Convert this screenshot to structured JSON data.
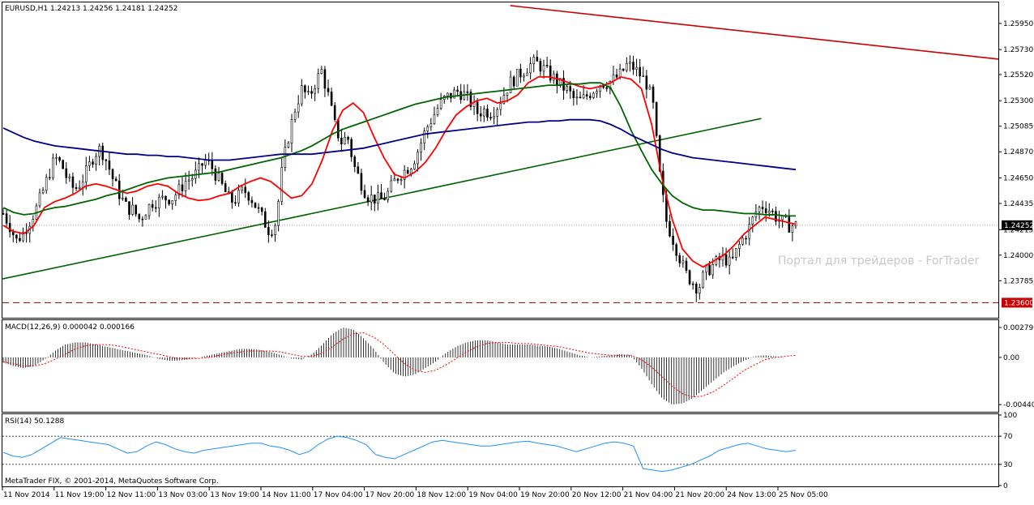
{
  "chart_data": {
    "type": "candlestick",
    "symbol_header": "EURUSD,H1  1.24213 1.24256 1.24181 1.24252",
    "watermark": "Портал для трейдеров - ForTrader",
    "copyright": "MetaTrader FIX, © 2001-2014, MetaQuotes Software Corp.",
    "current_price_label": "1.24252",
    "support_label": "1.23600",
    "price_ylim": [
      1.2348,
      1.2612
    ],
    "price_ticks": [
      "1.25950",
      "1.25730",
      "1.25520",
      "1.25300",
      "1.25085",
      "1.24870",
      "1.24650",
      "1.24435",
      "1.24215",
      "1.24000",
      "1.23785"
    ],
    "x_tick_labels": [
      "11 Nov 2014",
      "11 Nov 19:00",
      "12 Nov 11:00",
      "13 Nov 03:00",
      "13 Nov 19:00",
      "14 Nov 11:00",
      "17 Nov 04:00",
      "17 Nov 20:00",
      "18 Nov 12:00",
      "19 Nov 04:00",
      "19 Nov 20:00",
      "20 Nov 12:00",
      "21 Nov 04:00",
      "21 Nov 20:00",
      "24 Nov 13:00",
      "25 Nov 05:00"
    ],
    "close_series": [
      1.2435,
      1.2425,
      1.2412,
      1.2418,
      1.2428,
      1.2438,
      1.2452,
      1.2468,
      1.2482,
      1.2476,
      1.2462,
      1.2455,
      1.2462,
      1.2472,
      1.2485,
      1.249,
      1.2478,
      1.2462,
      1.245,
      1.244,
      1.2438,
      1.243,
      1.2438,
      1.2445,
      1.2446,
      1.2448,
      1.2448,
      1.2454,
      1.2462,
      1.2465,
      1.247,
      1.248,
      1.2475,
      1.2465,
      1.2455,
      1.2445,
      1.2448,
      1.2455,
      1.245,
      1.244,
      1.243,
      1.242,
      1.2428,
      1.2475,
      1.2502,
      1.2525,
      1.254,
      1.2532,
      1.2545,
      1.2555,
      1.2535,
      1.251,
      1.2495,
      1.25,
      1.2475,
      1.2462,
      1.245,
      1.2448,
      1.2446,
      1.245,
      1.246,
      1.2468,
      1.2472,
      1.2478,
      1.249,
      1.2505,
      1.2515,
      1.2525,
      1.2532,
      1.2535,
      1.2538,
      1.2535,
      1.2528,
      1.252,
      1.2522,
      1.252,
      1.2525,
      1.2535,
      1.2545,
      1.255,
      1.2555,
      1.256,
      1.2562,
      1.2558,
      1.2552,
      1.2548,
      1.2542,
      1.2538,
      1.253,
      1.253,
      1.2535,
      1.254,
      1.2545,
      1.2545,
      1.2548,
      1.2552,
      1.256,
      1.2558,
      1.2552,
      1.2545,
      1.2528,
      1.247,
      1.243,
      1.2415,
      1.24,
      1.2385,
      1.2378,
      1.2372,
      1.2385,
      1.239,
      1.2395,
      1.2398,
      1.2392,
      1.2405,
      1.2415,
      1.2425,
      1.2438,
      1.2442,
      1.2438,
      1.2432,
      1.2428,
      1.2425,
      1.2425
    ],
    "moving_averages": [
      {
        "color": "#ff0000",
        "values": [
          1.2425,
          1.242,
          1.2418,
          1.2425,
          1.244,
          1.2445,
          1.2448,
          1.2452,
          1.2458,
          1.246,
          1.2458,
          1.2455,
          1.2452,
          1.2454,
          1.2458,
          1.246,
          1.2458,
          1.2452,
          1.2448,
          1.2446,
          1.2447,
          1.245,
          1.2452,
          1.2458,
          1.2462,
          1.2465,
          1.2462,
          1.2455,
          1.2448,
          1.245,
          1.246,
          1.248,
          1.2505,
          1.2522,
          1.2528,
          1.252,
          1.25,
          1.2482,
          1.2468,
          1.2465,
          1.247,
          1.2478,
          1.249,
          1.2505,
          1.2518,
          1.2525,
          1.253,
          1.2532,
          1.2528,
          1.253,
          1.2535,
          1.2545,
          1.255,
          1.255,
          1.2548,
          1.2545,
          1.2542,
          1.254,
          1.2542,
          1.2545,
          1.255,
          1.2548,
          1.254,
          1.251,
          1.2465,
          1.243,
          1.2405,
          1.2395,
          1.239,
          1.2395,
          1.24,
          1.2408,
          1.2418,
          1.2425,
          1.2432,
          1.243,
          1.2428,
          1.2426
        ]
      },
      {
        "color": "#006400",
        "values": [
          1.244,
          1.2436,
          1.2434,
          1.2435,
          1.2438,
          1.244,
          1.2441,
          1.2443,
          1.2445,
          1.2447,
          1.245,
          1.2452,
          1.2455,
          1.2458,
          1.2461,
          1.2463,
          1.2465,
          1.2466,
          1.2467,
          1.2468,
          1.2469,
          1.247,
          1.2472,
          1.2474,
          1.2476,
          1.2478,
          1.248,
          1.2482,
          1.2485,
          1.2488,
          1.2492,
          1.2497,
          1.2502,
          1.2506,
          1.2509,
          1.2512,
          1.2515,
          1.2518,
          1.2521,
          1.2524,
          1.2527,
          1.2529,
          1.2531,
          1.2533,
          1.2534,
          1.2535,
          1.2536,
          1.2537,
          1.2538,
          1.2539,
          1.254,
          1.2541,
          1.2542,
          1.2543,
          1.2543,
          1.2544,
          1.2544,
          1.2545,
          1.2545,
          1.2541,
          1.2525,
          1.2505,
          1.2488,
          1.2472,
          1.246,
          1.245,
          1.2444,
          1.244,
          1.2438,
          1.2438,
          1.2437,
          1.2436,
          1.2435,
          1.2435,
          1.2434,
          1.2434,
          1.2433,
          1.2433
        ]
      },
      {
        "color": "#00008b",
        "values": [
          1.2507,
          1.2503,
          1.2499,
          1.2496,
          1.2494,
          1.2492,
          1.2491,
          1.249,
          1.2489,
          1.2488,
          1.2487,
          1.2486,
          1.2485,
          1.2485,
          1.2484,
          1.2484,
          1.2483,
          1.2483,
          1.2482,
          1.2481,
          1.248,
          1.248,
          1.248,
          1.2481,
          1.2482,
          1.2483,
          1.2484,
          1.2485,
          1.2485,
          1.2485,
          1.2485,
          1.2486,
          1.2487,
          1.2488,
          1.2489,
          1.249,
          1.2492,
          1.2494,
          1.2496,
          1.2498,
          1.25,
          1.2502,
          1.2503,
          1.2504,
          1.2505,
          1.2506,
          1.2507,
          1.2508,
          1.2509,
          1.251,
          1.2511,
          1.2512,
          1.2512,
          1.2513,
          1.2513,
          1.2514,
          1.2514,
          1.2514,
          1.2513,
          1.251,
          1.2506,
          1.2501,
          1.2497,
          1.2493,
          1.2489,
          1.2486,
          1.2484,
          1.2482,
          1.2481,
          1.248,
          1.2479,
          1.2478,
          1.2477,
          1.2476,
          1.2475,
          1.2474,
          1.2473,
          1.2472
        ]
      }
    ],
    "trendlines": [
      {
        "color": "#006400",
        "from": [
          0,
          1.238
        ],
        "to": [
          0.762,
          1.2515
        ]
      },
      {
        "color": "#cc0000",
        "from": [
          0.51,
          1.261
        ],
        "to": [
          1.0,
          1.2565
        ]
      }
    ],
    "support_level": 1.236,
    "macd": {
      "header": "MACD(12,26,9) 0.000042 0.000166",
      "ylim": [
        -0.005,
        0.0034
      ],
      "ticks": [
        "0.002796",
        "0.00",
        "-0.004407"
      ],
      "histogram": [
        -0.0005,
        -0.0008,
        -0.001,
        -0.0008,
        -0.0002,
        0.0006,
        0.0012,
        0.0014,
        0.0014,
        0.0012,
        0.001,
        0.0008,
        0.0006,
        0.0004,
        0.0002,
        -0.0001,
        -0.0003,
        -0.0003,
        -0.0002,
        0.0,
        0.0002,
        0.0004,
        0.0006,
        0.0008,
        0.0008,
        0.0007,
        0.0005,
        0.0002,
        -0.0001,
        -0.0002,
        0.0003,
        0.0012,
        0.0022,
        0.0028,
        0.0026,
        0.0018,
        0.0008,
        -0.0005,
        -0.0015,
        -0.0018,
        -0.0016,
        -0.001,
        -0.0004,
        0.0004,
        0.001,
        0.0014,
        0.0016,
        0.0016,
        0.0014,
        0.0012,
        0.0012,
        0.0012,
        0.0011,
        0.001,
        0.0008,
        0.0005,
        0.0002,
        0.0,
        0.0001,
        0.0002,
        0.0003,
        0.0002,
        -0.001,
        -0.0025,
        -0.0038,
        -0.0044,
        -0.0043,
        -0.0038,
        -0.003,
        -0.0022,
        -0.0014,
        -0.0008,
        -0.0003,
        0.0001,
        0.0002,
        0.0001,
        0.0,
        0.0
      ],
      "signal": [
        -0.0004,
        -0.0006,
        -0.0008,
        -0.0008,
        -0.0006,
        -0.0002,
        0.0003,
        0.0008,
        0.0011,
        0.0012,
        0.0012,
        0.0011,
        0.0009,
        0.0007,
        0.0005,
        0.0003,
        0.0001,
        -0.0001,
        -0.0001,
        -0.0001,
        0.0,
        0.0002,
        0.0004,
        0.0005,
        0.0006,
        0.0006,
        0.0006,
        0.0005,
        0.0003,
        0.0001,
        0.0001,
        0.0004,
        0.001,
        0.0017,
        0.0022,
        0.0023,
        0.0019,
        0.0012,
        0.0003,
        -0.0006,
        -0.0012,
        -0.0014,
        -0.0012,
        -0.0007,
        -0.0001,
        0.0005,
        0.001,
        0.0013,
        0.0014,
        0.0014,
        0.0013,
        0.0013,
        0.0012,
        0.0011,
        0.001,
        0.0008,
        0.0006,
        0.0004,
        0.0003,
        0.0002,
        0.0002,
        0.0002,
        -0.0002,
        -0.0009,
        -0.0018,
        -0.0027,
        -0.0034,
        -0.0037,
        -0.0036,
        -0.0032,
        -0.0026,
        -0.0019,
        -0.0012,
        -0.0007,
        -0.0002,
        0.0,
        0.0001,
        0.0002
      ]
    },
    "rsi": {
      "header": "RSI(14) 50.1288",
      "ylim": [
        0,
        100
      ],
      "ticks": [
        "100",
        "70",
        "30",
        "0"
      ],
      "levels": [
        70,
        30
      ],
      "values": [
        47,
        42,
        40,
        44,
        52,
        60,
        68,
        66,
        64,
        62,
        60,
        58,
        52,
        46,
        48,
        56,
        62,
        58,
        52,
        48,
        46,
        50,
        52,
        54,
        56,
        58,
        60,
        60,
        56,
        54,
        50,
        44,
        48,
        58,
        66,
        70,
        68,
        64,
        58,
        44,
        40,
        38,
        44,
        50,
        56,
        62,
        64,
        62,
        60,
        58,
        56,
        56,
        58,
        60,
        62,
        63,
        60,
        58,
        56,
        52,
        48,
        52,
        56,
        60,
        62,
        60,
        56,
        24,
        22,
        20,
        22,
        26,
        30,
        36,
        42,
        50,
        54,
        58,
        60,
        56,
        52,
        50,
        48,
        50
      ]
    }
  }
}
